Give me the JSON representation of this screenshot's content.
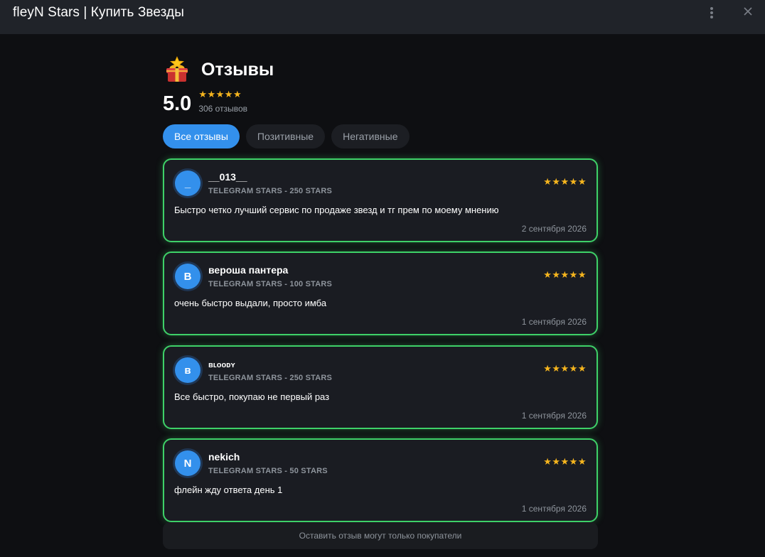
{
  "window": {
    "title": "fleyN Stars | Купить Звезды",
    "menu_icon": "more-vertical-icon",
    "close_icon": "close-icon"
  },
  "header": {
    "icon": "gift-box-icon",
    "title": "Отзывы"
  },
  "rating": {
    "score": "5.0",
    "stars": "★★★★★",
    "stars_value": 5,
    "count_label": "306 отзывов"
  },
  "tabs": [
    {
      "label": "Все отзывы",
      "active": true
    },
    {
      "label": "Позитивные",
      "active": false
    },
    {
      "label": "Негативные",
      "active": false
    }
  ],
  "reviews": [
    {
      "avatar_letter": "_",
      "name": "__013__",
      "product": "TELEGRAM STARS - 250 STARS",
      "stars": "★★★★★",
      "rating": 5,
      "text": "Быстро четко лучший сервис по продаже звезд и тг прем по моему мнению",
      "date": "2 сентября 2026"
    },
    {
      "avatar_letter": "В",
      "name": "вероша пантера",
      "product": "TELEGRAM STARS - 100 STARS",
      "stars": "★★★★★",
      "rating": 5,
      "text": "очень быстро выдали, просто имба",
      "date": "1 сентября 2026"
    },
    {
      "avatar_letter": "ʙ",
      "name": "ʙʟᴏᴏᴅʏ",
      "product": "TELEGRAM STARS - 250 STARS",
      "stars": "★★★★★",
      "rating": 5,
      "text": "Все быстро, покупаю не первый раз",
      "date": "1 сентября 2026"
    },
    {
      "avatar_letter": "N",
      "name": "nekich",
      "product": "TELEGRAM STARS - 50 STARS",
      "stars": "★★★★★",
      "rating": 5,
      "text": "флейн жду ответа день 1",
      "date": "1 сентября 2026"
    }
  ],
  "footer": {
    "note": "Оставить отзыв могут только покупатели"
  },
  "colors": {
    "background": "#0e0f12",
    "titlebar": "#202329",
    "accent_blue": "#3390ec",
    "star_gold": "#f6b51e",
    "card_border_green": "#3ed168",
    "muted_text": "#8e949c"
  }
}
